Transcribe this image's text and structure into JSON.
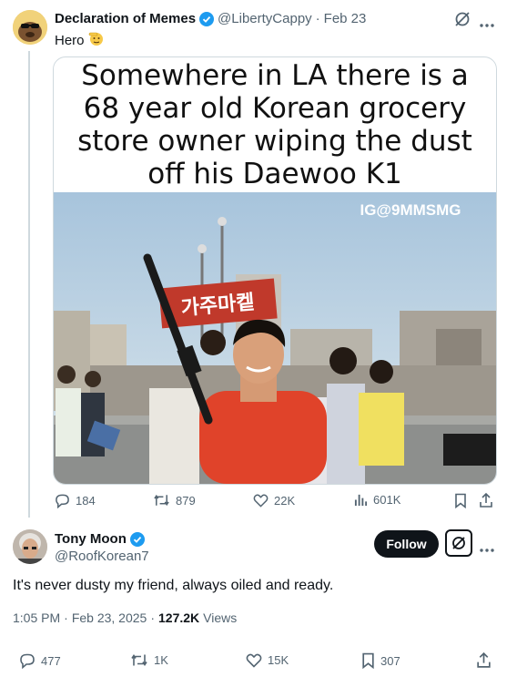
{
  "post": {
    "author_name": "Declaration of Memes",
    "author_handle": "@LibertyCappy",
    "separator": "·",
    "date": "Feb 23",
    "text": "Hero",
    "meme_caption": [
      "Somewhere in LA there is a",
      "68 year old Korean grocery",
      "store owner wiping the dust",
      "off his Daewoo K1"
    ],
    "watermark": "IG@9MMSMG",
    "sign_text": "가주마켙",
    "stats": {
      "replies": "184",
      "reposts": "879",
      "likes": "22K",
      "views": "601K"
    }
  },
  "reply": {
    "author_name": "Tony Moon",
    "author_handle": "@RoofKorean7",
    "follow_label": "Follow",
    "text": "It's never dusty my friend, always oiled and ready.",
    "time": "1:05 PM",
    "separator": "·",
    "date": "Feb 23, 2025",
    "separator2": "·",
    "views_count": "127.2K",
    "views_label": "Views",
    "stats": {
      "replies": "477",
      "reposts": "1K",
      "likes": "15K",
      "bookmarks": "307"
    }
  },
  "colors": {
    "verified": "#1d9bf0",
    "muted": "#536471",
    "text": "#0f1419",
    "shirt": "#e0432a"
  },
  "icons": [
    "grok-icon",
    "more-icon",
    "reply-icon",
    "repost-icon",
    "like-icon",
    "views-icon",
    "bookmark-icon",
    "share-icon",
    "verified-badge-icon",
    "salute-emoji-icon"
  ]
}
